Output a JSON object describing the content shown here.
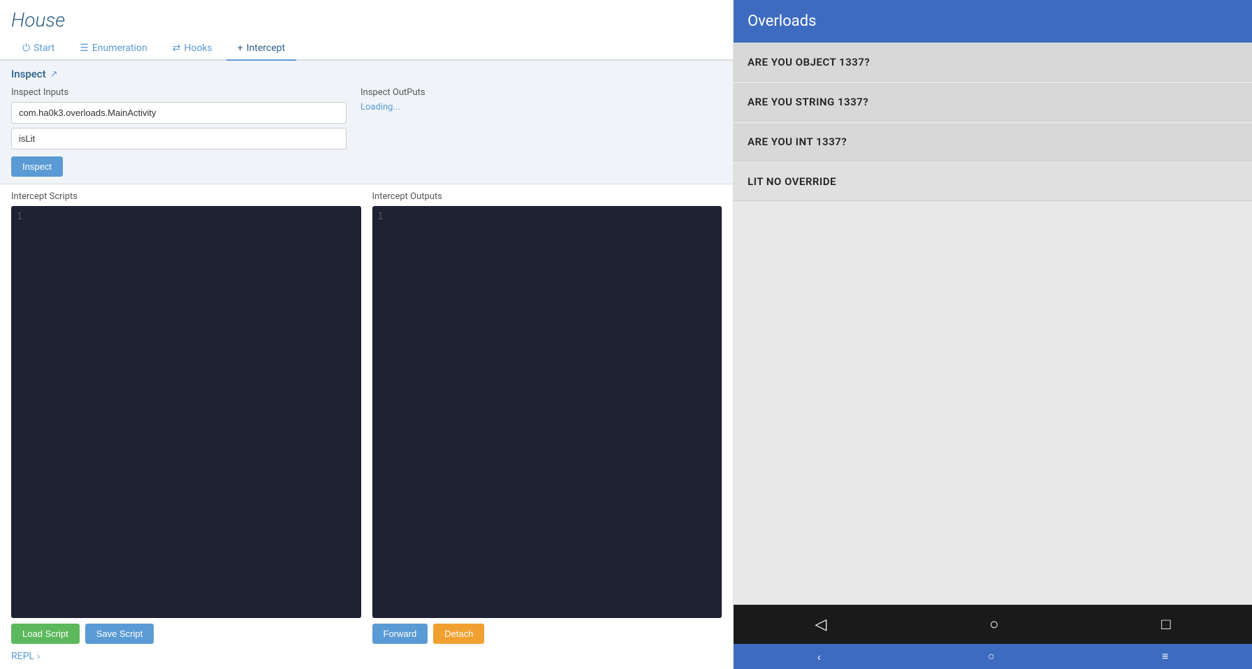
{
  "app": {
    "title": "House"
  },
  "tabs": [
    {
      "id": "start",
      "label": "Start",
      "icon": "⏻",
      "active": false
    },
    {
      "id": "enumeration",
      "label": "Enumeration",
      "icon": "☰",
      "active": false
    },
    {
      "id": "hooks",
      "label": "Hooks",
      "icon": "⇄",
      "active": false
    },
    {
      "id": "intercept",
      "label": "Intercept",
      "icon": "+",
      "active": true
    }
  ],
  "inspect": {
    "header": "Inspect",
    "link_icon": "↗",
    "inputs_label": "Inspect Inputs",
    "class_value": "com.ha0k3.overloads.MainActivity",
    "method_value": "isLit",
    "button_label": "Inspect",
    "outputs_label": "Inspect OutPuts",
    "loading_text": "Loading..."
  },
  "intercept_scripts": {
    "label": "Intercept Scripts",
    "line_number": "1",
    "load_button": "Load Script",
    "save_button": "Save Script"
  },
  "intercept_outputs": {
    "label": "Intercept Outputs",
    "line_number": "1",
    "forward_button": "Forward",
    "detach_button": "Detach"
  },
  "repl": {
    "label": "REPL",
    "icon": "›"
  },
  "overloads": {
    "title": "Overloads",
    "items": [
      {
        "id": "obj",
        "text": "ARE YOU OBJECT 1337?"
      },
      {
        "id": "str",
        "text": "ARE YOU STRING 1337?"
      },
      {
        "id": "int",
        "text": "ARE YOU INT 1337?"
      },
      {
        "id": "lit",
        "text": "LIT NO OVERRIDE"
      }
    ]
  },
  "android_nav": {
    "back_icon": "◁",
    "home_icon": "○",
    "recents_icon": "□"
  },
  "android_bottom_bar": {
    "back_icon": "‹",
    "home_icon": "○",
    "menu_icon": "≡"
  }
}
